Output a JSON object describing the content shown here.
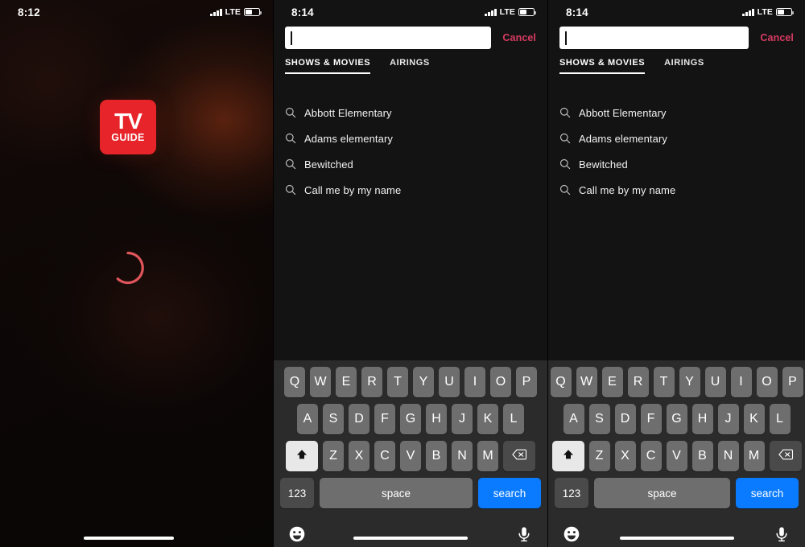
{
  "colors": {
    "brand_red": "#E62429",
    "cancel_pink": "#D93B63",
    "keyboard_bg": "#2B2B2B",
    "key_gray": "#6E6E6E",
    "key_dark": "#4A4A4A",
    "search_blue": "#0A7BFF",
    "spinner_red": "#E0555A",
    "screen_black": "#131313"
  },
  "panels": [
    {
      "id": "splash",
      "status_bar": {
        "time": "8:12",
        "carrier_tech": "LTE",
        "signal_icon": "signal-bars-icon",
        "battery_icon": "battery-icon",
        "battery_level": 48
      },
      "logo": {
        "line1": "TV",
        "line2": "GUIDE",
        "name": "tv-guide-logo"
      },
      "spinner": {
        "name": "loading-spinner",
        "label": "Loading"
      },
      "home_indicator": "home-indicator"
    },
    {
      "id": "search-left",
      "status_bar": {
        "time": "8:14",
        "carrier_tech": "LTE",
        "signal_icon": "signal-bars-icon",
        "battery_icon": "battery-icon",
        "battery_level": 48
      },
      "search": {
        "value": "",
        "placeholder": "",
        "cancel_label": "Cancel",
        "caret_visible": true
      },
      "tabs": [
        {
          "label": "SHOWS & MOVIES",
          "active": true
        },
        {
          "label": "AIRINGS",
          "active": false
        }
      ],
      "suggestions": [
        {
          "icon": "magnifier-icon",
          "label": "Abbott Elementary"
        },
        {
          "icon": "magnifier-icon",
          "label": "Adams elementary"
        },
        {
          "icon": "magnifier-icon",
          "label": "Bewitched"
        },
        {
          "icon": "magnifier-icon",
          "label": "Call me by my name"
        }
      ],
      "home_indicator": "home-indicator"
    },
    {
      "id": "search-right",
      "status_bar": {
        "time": "8:14",
        "carrier_tech": "LTE",
        "signal_icon": "signal-bars-icon",
        "battery_icon": "battery-icon",
        "battery_level": 48
      },
      "search": {
        "value": "",
        "placeholder": "",
        "cancel_label": "Cancel",
        "caret_visible": true
      },
      "tabs": [
        {
          "label": "SHOWS & MOVIES",
          "active": true
        },
        {
          "label": "AIRINGS",
          "active": false
        }
      ],
      "suggestions": [
        {
          "icon": "magnifier-icon",
          "label": "Abbott Elementary"
        },
        {
          "icon": "magnifier-icon",
          "label": "Adams elementary"
        },
        {
          "icon": "magnifier-icon",
          "label": "Bewitched"
        },
        {
          "icon": "magnifier-icon",
          "label": "Call me by my name"
        }
      ],
      "home_indicator": "home-indicator"
    }
  ],
  "keyboard": {
    "row1": [
      "Q",
      "W",
      "E",
      "R",
      "T",
      "Y",
      "U",
      "I",
      "O",
      "P"
    ],
    "row2": [
      "A",
      "S",
      "D",
      "F",
      "G",
      "H",
      "J",
      "K",
      "L"
    ],
    "row3": [
      "Z",
      "X",
      "C",
      "V",
      "B",
      "N",
      "M"
    ],
    "shift_icon": "shift-up-arrow-icon",
    "shift_active": true,
    "backspace_icon": "backspace-delete-icon",
    "numbers_label": "123",
    "space_label": "space",
    "return_label": "search",
    "emoji_icon": "emoji-smiley-icon",
    "dictation_icon": "microphone-icon"
  }
}
